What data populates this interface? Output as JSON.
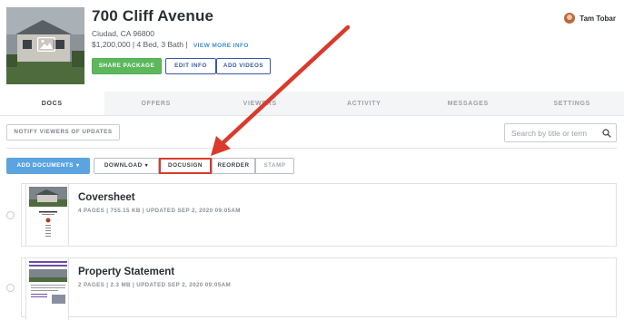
{
  "listing": {
    "title": "700 Cliff Avenue",
    "city": "Ciudad, CA 96800",
    "details": "$1,200,000 | 4 Bed, 3 Bath |",
    "view_more": "VIEW MORE INFO"
  },
  "buttons": {
    "share": "SHARE PACKAGE",
    "edit": "EDIT INFO",
    "videos": "ADD VIDEOS"
  },
  "user": {
    "name": "Tam Tobar"
  },
  "tabs": [
    {
      "label": "DOCS",
      "active": true
    },
    {
      "label": "OFFERS"
    },
    {
      "label": "VIEWERS"
    },
    {
      "label": "ACTIVITY"
    },
    {
      "label": "MESSAGES"
    },
    {
      "label": "SETTINGS"
    }
  ],
  "toolbar": {
    "notify": "NOTIFY VIEWERS OF UPDATES",
    "search_placeholder": "Search by title or term",
    "add_documents": "ADD DOCUMENTS",
    "download": "DOWNLOAD",
    "docusign": "DOCUSIGN",
    "reorder": "REORDER",
    "stamp": "STAMP"
  },
  "documents": [
    {
      "name": "Coversheet",
      "meta": "4 PAGES | 755.15 KB | UPDATED SEP 2, 2020 09:05AM"
    },
    {
      "name": "Property Statement",
      "meta": "2 PAGES | 2.3 MB | UPDATED SEP 2, 2020 09:05AM"
    }
  ],
  "colors": {
    "accent_green": "#5cb85c",
    "accent_blue": "#5ba4e0",
    "link_blue": "#3a8fd6",
    "highlight_red": "#d93a2b"
  }
}
